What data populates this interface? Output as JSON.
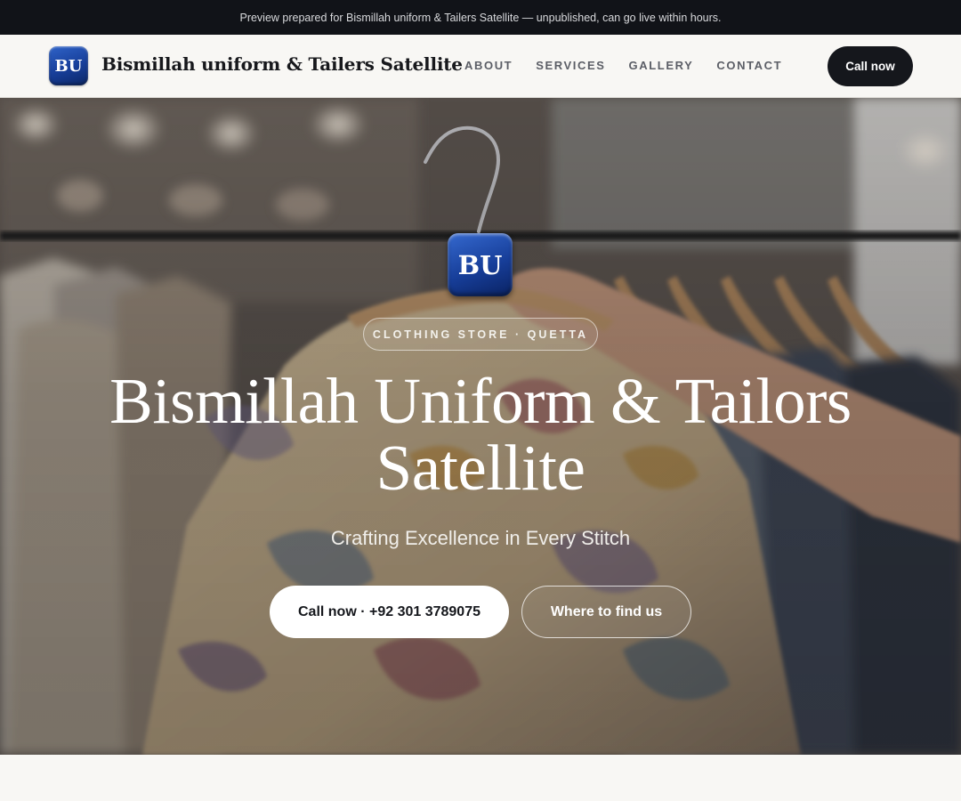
{
  "preview_banner": {
    "text": "Preview prepared for Bismillah uniform & Tailers Satellite — unpublished, can go live within hours."
  },
  "header": {
    "logo_text": "BU",
    "brand_name": "Bismillah uniform & Tailers Satellite",
    "nav": [
      "ABOUT",
      "SERVICES",
      "GALLERY",
      "CONTACT"
    ],
    "cta_label": "Call now"
  },
  "hero": {
    "badge_text": "BU",
    "eyebrow": "CLOTHING STORE · QUETTA",
    "title_line1": "Bismillah Uniform & Tailors",
    "title_line2": "Satellite",
    "tagline": "Crafting Excellence in Every Stitch",
    "primary_button": "Call now · +92 301 3789075",
    "secondary_button": "Where to find us",
    "background_image": "clothing-rack-with-hanging-shirt-photo"
  },
  "colors": {
    "topbar_bg": "#111318",
    "page_bg": "#f8f7f4",
    "dark_button": "#15171c",
    "logo_blue": "#173e99"
  }
}
